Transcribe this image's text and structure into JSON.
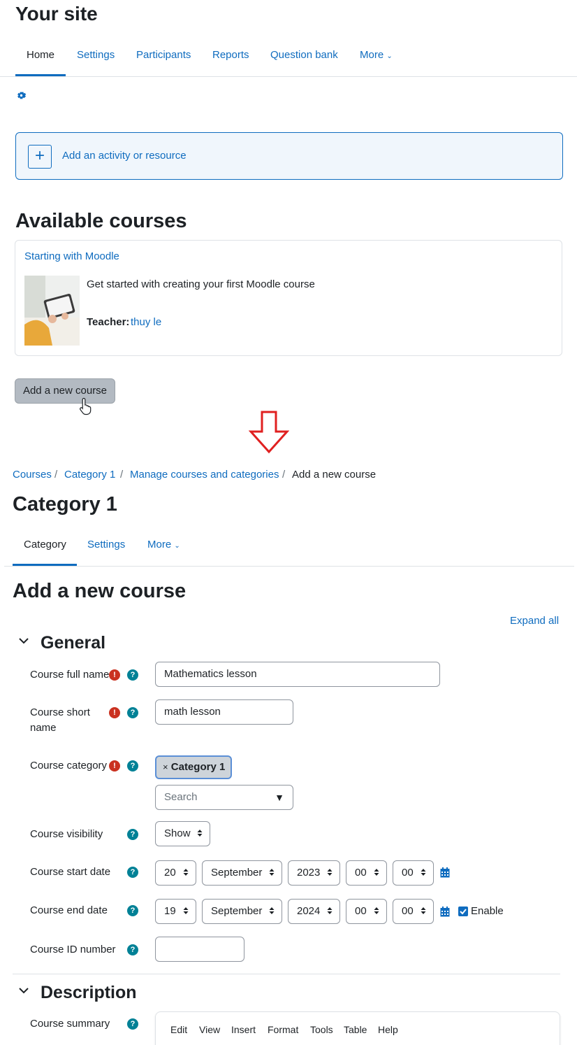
{
  "top": {
    "site_title": "Your site",
    "tabs": [
      "Home",
      "Settings",
      "Participants",
      "Reports",
      "Question bank",
      "More"
    ],
    "add_activity_label": "Add an activity or resource",
    "available_courses_title": "Available courses",
    "course": {
      "name": "Starting with Moodle",
      "summary": "Get started with creating your first Moodle course",
      "teacher_label": "Teacher:",
      "teacher_name": "thuy le"
    },
    "add_course_button": "Add a new course"
  },
  "bottom": {
    "breadcrumb": [
      "Courses",
      "Category 1",
      "Manage courses and categories",
      "Add a new course"
    ],
    "category_title": "Category 1",
    "tabs": [
      "Category",
      "Settings",
      "More"
    ],
    "page_title": "Add a new course",
    "expand_all": "Expand all",
    "general_section": "General",
    "fields": {
      "full_name_label": "Course full name",
      "full_name_value": "Mathematics lesson",
      "short_name_label_1": "Course short",
      "short_name_label_2": "name",
      "short_name_value": "math lesson",
      "category_label": "Course category",
      "category_chip": "Category 1",
      "category_search_placeholder": "Search",
      "visibility_label": "Course visibility",
      "visibility_value": "Show",
      "start_date_label": "Course start date",
      "start_date": {
        "day": "20",
        "month": "September",
        "year": "2023",
        "hour": "00",
        "minute": "00"
      },
      "end_date_label": "Course end date",
      "end_date": {
        "day": "19",
        "month": "September",
        "year": "2024",
        "hour": "00",
        "minute": "00"
      },
      "end_enable_label": "Enable",
      "id_number_label": "Course ID number"
    },
    "description_section": "Description",
    "summary_label": "Course summary",
    "editor_menu": [
      "Edit",
      "View",
      "Insert",
      "Format",
      "Tools",
      "Table",
      "Help"
    ]
  },
  "colors": {
    "link": "#0f6cbf",
    "required": "#ca3120",
    "help": "#008196",
    "arrow": "#e02020"
  }
}
